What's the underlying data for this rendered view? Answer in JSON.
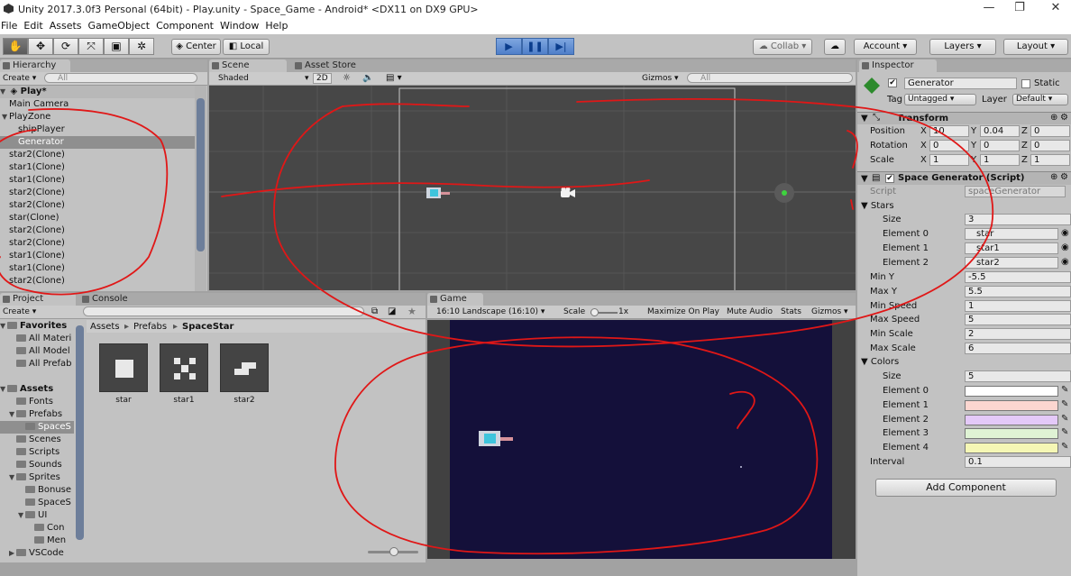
{
  "titlebar": {
    "title": "Unity 2017.3.0f3 Personal (64bit) - Play.unity - Space_Game - Android* <DX11 on DX9 GPU>",
    "minimize": "—",
    "restore": "❐",
    "close": "✕"
  },
  "menu": [
    "File",
    "Edit",
    "Assets",
    "GameObject",
    "Component",
    "Window",
    "Help"
  ],
  "toolbar": {
    "center": "Center",
    "local": "Local",
    "collab": "Collab",
    "account": "Account",
    "layers": "Layers",
    "layout": "Layout"
  },
  "hierarchy": {
    "tab": "Hierarchy",
    "create": "Create",
    "search": "All",
    "scene": "Play*",
    "items": [
      {
        "label": "Main Camera",
        "indent": 1,
        "sel": false
      },
      {
        "label": "PlayZone",
        "indent": 1,
        "fold": "▼",
        "sel": false
      },
      {
        "label": "shipPlayer",
        "indent": 2,
        "sel": false
      },
      {
        "label": "Generator",
        "indent": 2,
        "sel": true
      },
      {
        "label": "star2(Clone)",
        "indent": 1,
        "sel": false
      },
      {
        "label": "star1(Clone)",
        "indent": 1,
        "sel": false
      },
      {
        "label": "star1(Clone)",
        "indent": 1,
        "sel": false
      },
      {
        "label": "star2(Clone)",
        "indent": 1,
        "sel": false
      },
      {
        "label": "star2(Clone)",
        "indent": 1,
        "sel": false
      },
      {
        "label": "star(Clone)",
        "indent": 1,
        "sel": false
      },
      {
        "label": "star2(Clone)",
        "indent": 1,
        "sel": false
      },
      {
        "label": "star2(Clone)",
        "indent": 1,
        "sel": false
      },
      {
        "label": "star1(Clone)",
        "indent": 1,
        "sel": false
      },
      {
        "label": "star1(Clone)",
        "indent": 1,
        "sel": false
      },
      {
        "label": "star2(Clone)",
        "indent": 1,
        "sel": false
      }
    ]
  },
  "scene": {
    "tab": "Scene",
    "tab2": "Asset Store",
    "shaded": "Shaded",
    "twod": "2D",
    "gizmos": "Gizmos",
    "search": "All"
  },
  "project": {
    "tab": "Project",
    "tab2": "Console",
    "create": "Create",
    "tree": [
      {
        "label": "Favorites",
        "bold": true,
        "indent": 0,
        "fold": "▼"
      },
      {
        "label": "All Materi",
        "indent": 1
      },
      {
        "label": "All Model",
        "indent": 1
      },
      {
        "label": "All Prefab",
        "indent": 1
      },
      {
        "label": "",
        "indent": 0
      },
      {
        "label": "Assets",
        "bold": true,
        "indent": 0,
        "fold": "▼"
      },
      {
        "label": "Fonts",
        "indent": 1
      },
      {
        "label": "Prefabs",
        "indent": 1,
        "fold": "▼"
      },
      {
        "label": "SpaceS",
        "indent": 2,
        "sel": true
      },
      {
        "label": "Scenes",
        "indent": 1
      },
      {
        "label": "Scripts",
        "indent": 1
      },
      {
        "label": "Sounds",
        "indent": 1
      },
      {
        "label": "Sprites",
        "indent": 1,
        "fold": "▼"
      },
      {
        "label": "Bonuse",
        "indent": 2
      },
      {
        "label": "SpaceS",
        "indent": 2
      },
      {
        "label": "UI",
        "indent": 2,
        "fold": "▼"
      },
      {
        "label": "Con",
        "indent": 3
      },
      {
        "label": "Men",
        "indent": 3
      },
      {
        "label": "VSCode",
        "indent": 1,
        "fold": "▶"
      }
    ],
    "crumbs": [
      "Assets",
      "Prefabs",
      "SpaceStar"
    ],
    "assets": [
      "star",
      "star1",
      "star2"
    ]
  },
  "game": {
    "tab": "Game",
    "aspect": "16:10 Landscape (16:10)",
    "scale_label": "Scale",
    "scale_value": "1x",
    "maximize": "Maximize On Play",
    "mute": "Mute Audio",
    "stats": "Stats",
    "gizmos": "Gizmos"
  },
  "inspector": {
    "tab": "Inspector",
    "name": "Generator",
    "static": "Static",
    "tag_label": "Tag",
    "tag": "Untagged",
    "layer_label": "Layer",
    "layer": "Default",
    "transform": {
      "title": "Transform",
      "rows": [
        {
          "label": "Position",
          "x": "10",
          "y": "0.04",
          "z": "0"
        },
        {
          "label": "Rotation",
          "x": "0",
          "y": "0",
          "z": "0"
        },
        {
          "label": "Scale",
          "x": "1",
          "y": "1",
          "z": "1"
        }
      ]
    },
    "script": {
      "title": "Space Generator (Script)",
      "script_label": "Script",
      "script_value": "spaceGenerator",
      "stars_label": "Stars",
      "size_label": "Size",
      "stars_size": "3",
      "stars": [
        {
          "label": "Element 0",
          "value": "star"
        },
        {
          "label": "Element 1",
          "value": "star1"
        },
        {
          "label": "Element 2",
          "value": "star2"
        }
      ],
      "props": [
        {
          "label": "Min Y",
          "value": "-5.5"
        },
        {
          "label": "Max Y",
          "value": "5.5"
        },
        {
          "label": "Min Speed",
          "value": "1"
        },
        {
          "label": "Max Speed",
          "value": "5"
        },
        {
          "label": "Min Scale",
          "value": "2"
        },
        {
          "label": "Max Scale",
          "value": "6"
        }
      ],
      "colors_label": "Colors",
      "colors_size": "5",
      "colors": [
        {
          "label": "Element 0",
          "hex": "#ffffff"
        },
        {
          "label": "Element 1",
          "hex": "#fcd6d0"
        },
        {
          "label": "Element 2",
          "hex": "#e4c9f8"
        },
        {
          "label": "Element 3",
          "hex": "#dff3d4"
        },
        {
          "label": "Element 4",
          "hex": "#f5f7b5"
        }
      ],
      "interval_label": "Interval",
      "interval": "0.1"
    },
    "add_component": "Add Component"
  }
}
